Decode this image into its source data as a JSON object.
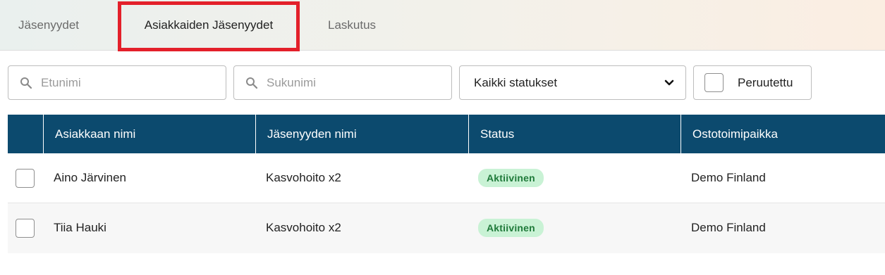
{
  "tabs": [
    {
      "label": "Jäsenyydet",
      "active": false
    },
    {
      "label": "Asiakkaiden Jäsenyydet",
      "active": true,
      "highlighted": true
    },
    {
      "label": "Laskutus",
      "active": false
    }
  ],
  "filters": {
    "first_name_placeholder": "Etunimi",
    "first_name_value": "",
    "last_name_placeholder": "Sukunimi",
    "last_name_value": "",
    "status_selected": "Kaikki statukset",
    "cancelled_label": "Peruutettu",
    "cancelled_checked": false
  },
  "table": {
    "columns": [
      "Asiakkaan nimi",
      "Jäsenyyden nimi",
      "Status",
      "Ostotoimipaikka"
    ],
    "rows": [
      {
        "name": "Aino Järvinen",
        "membership": "Kasvohoito x2",
        "status": "Aktiivinen",
        "location": "Demo Finland",
        "checked": false
      },
      {
        "name": "Tiia Hauki",
        "membership": "Kasvohoito x2",
        "status": "Aktiivinen",
        "location": "Demo Finland",
        "checked": false
      }
    ]
  },
  "colors": {
    "header_bg": "#0c4a6e",
    "highlight_border": "#e3202a",
    "badge_bg": "#c9f2d5",
    "badge_text": "#1f7a3a"
  },
  "icons": {
    "search": "search-icon",
    "dropdown": "chevron-down-icon"
  }
}
